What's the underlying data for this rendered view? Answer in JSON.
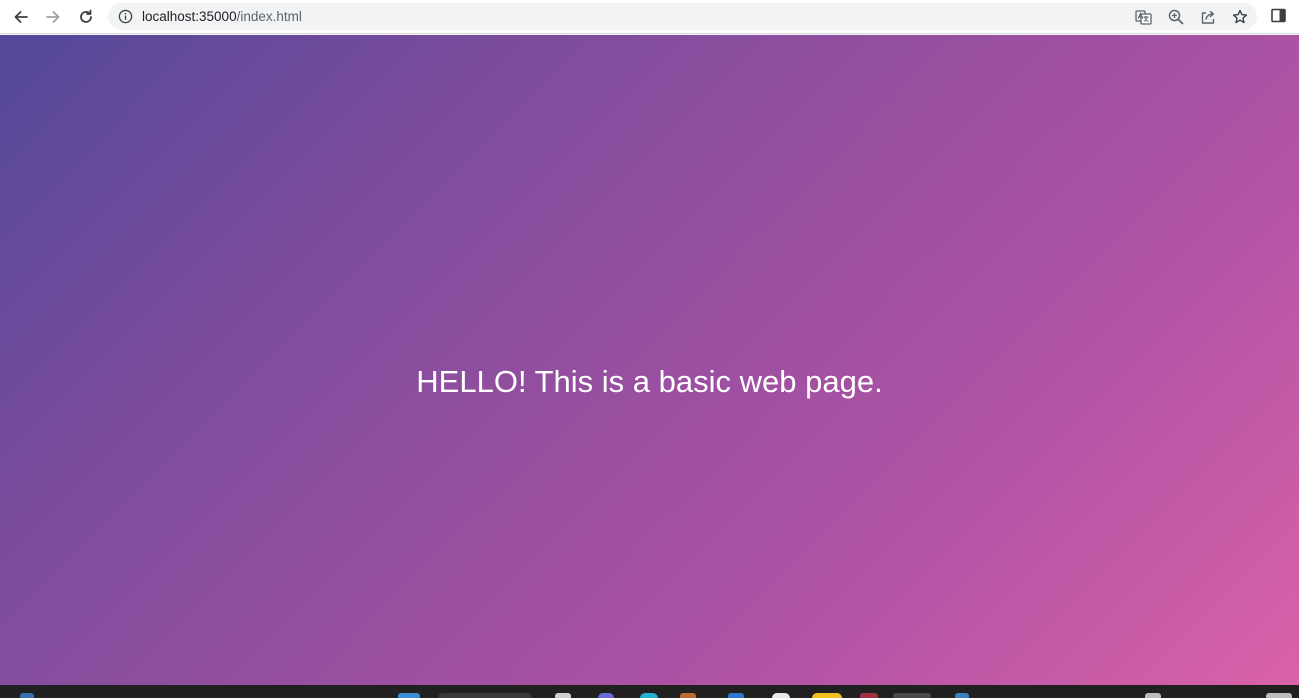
{
  "browser": {
    "url_host": "localhost:35000",
    "url_path": "/index.html",
    "icons": {
      "back": "arrow-left-icon",
      "forward": "arrow-right-icon",
      "reload": "reload-icon",
      "site_info": "info-icon",
      "translate": "translate-icon",
      "zoom": "zoom-icon",
      "share": "share-icon",
      "bookmark": "star-icon",
      "side_panel": "side-panel-icon"
    }
  },
  "page": {
    "heading": "HELLO! This is a basic web page.",
    "gradient": [
      "#52489a",
      "#d962a8"
    ]
  },
  "colors": {
    "toolbar_bg": "#ffffff",
    "omnibox_bg": "#f1f3f4",
    "taskbar_bg": "#202020"
  }
}
